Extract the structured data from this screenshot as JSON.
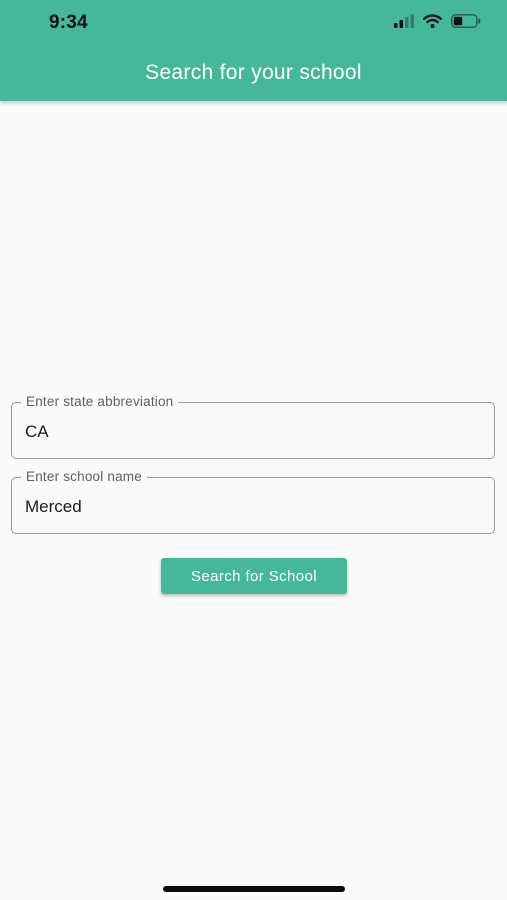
{
  "status_bar": {
    "time": "9:34",
    "battery_level": 0.4,
    "signal_bars": 2,
    "icons": [
      "cellular-signal-icon",
      "wifi-icon",
      "battery-icon"
    ]
  },
  "header": {
    "title": "Search for your school"
  },
  "form": {
    "state_field": {
      "label": "Enter state abbreviation",
      "value": "CA"
    },
    "school_field": {
      "label": "Enter school name",
      "value": "Merced"
    },
    "search_button_label": "Search for School"
  },
  "colors": {
    "accent": "#45b89a",
    "background": "#fafafa",
    "outline": "#9a9a9a"
  }
}
